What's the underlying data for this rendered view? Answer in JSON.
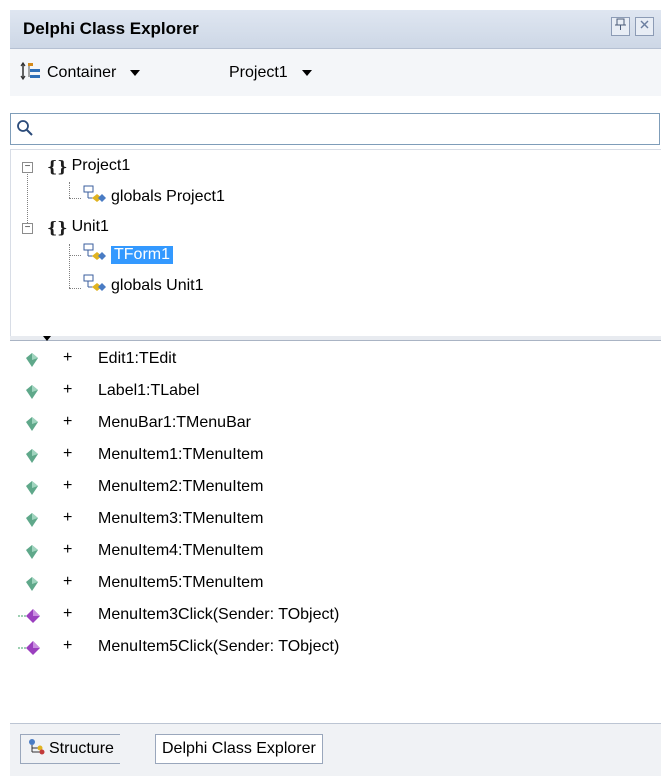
{
  "window": {
    "title": "Delphi Class Explorer",
    "pin_glyph": "⊕",
    "close_glyph": "⊠"
  },
  "toolbar": {
    "view_mode": "Container",
    "project": "Project1"
  },
  "search": {
    "placeholder": ""
  },
  "tree": {
    "nodes": [
      {
        "label": "Project1",
        "expander": "−",
        "icon": "namespace-icon"
      },
      {
        "label": "globals Project1",
        "icon": "class-icon"
      },
      {
        "label": "Unit1",
        "expander": "−",
        "icon": "namespace-icon"
      },
      {
        "label": "TForm1",
        "icon": "class-icon",
        "selected": true
      },
      {
        "label": "globals Unit1",
        "icon": "class-icon"
      }
    ]
  },
  "members": [
    {
      "label": "Edit1:TEdit",
      "kind": "field"
    },
    {
      "label": "Label1:TLabel",
      "kind": "field"
    },
    {
      "label": "MenuBar1:TMenuBar",
      "kind": "field"
    },
    {
      "label": "MenuItem1:TMenuItem",
      "kind": "field"
    },
    {
      "label": "MenuItem2:TMenuItem",
      "kind": "field"
    },
    {
      "label": "MenuItem3:TMenuItem",
      "kind": "field"
    },
    {
      "label": "MenuItem4:TMenuItem",
      "kind": "field"
    },
    {
      "label": "MenuItem5:TMenuItem",
      "kind": "field"
    },
    {
      "label": "MenuItem3Click(Sender: TObject)",
      "kind": "method"
    },
    {
      "label": "MenuItem5Click(Sender: TObject)",
      "kind": "method"
    }
  ],
  "member_visibility": "+",
  "tabs": [
    {
      "label": "Structure",
      "icon": "structure-icon"
    },
    {
      "label": "Delphi Class Explorer"
    }
  ],
  "colors": {
    "selection": "#3399ff",
    "field_icon": "#5fa88a",
    "method_icon": "#9b3fbf",
    "titlebar": "#d4dcea"
  }
}
